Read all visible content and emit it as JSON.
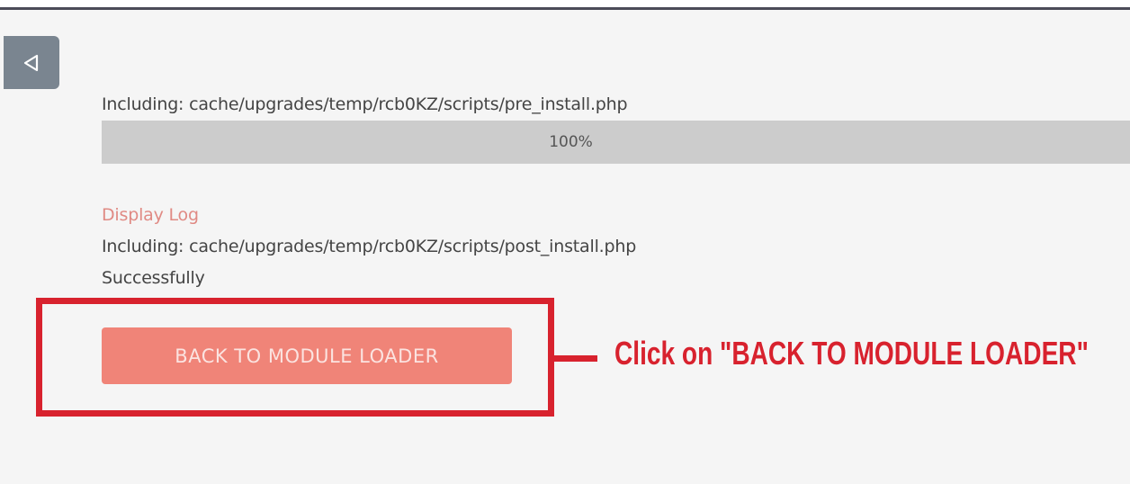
{
  "sidebar": {
    "toggle_icon": "collapse-left-icon"
  },
  "install": {
    "pre_install_line": "Including: cache/upgrades/temp/rcb0KZ/scripts/pre_install.php",
    "progress": {
      "percent": 100,
      "label": "100%"
    },
    "display_log_link": "Display Log",
    "post_install_line": "Including: cache/upgrades/temp/rcb0KZ/scripts/post_install.php",
    "status": "Successfully"
  },
  "actions": {
    "back_button_label": "BACK TO MODULE LOADER"
  },
  "annotation": {
    "callout_text": "Click on \"BACK TO MODULE LOADER\""
  },
  "colors": {
    "accent": "#f08478",
    "link": "#e08a84",
    "annotation": "#d8222e",
    "sidebar_toggle": "#7a8590"
  }
}
